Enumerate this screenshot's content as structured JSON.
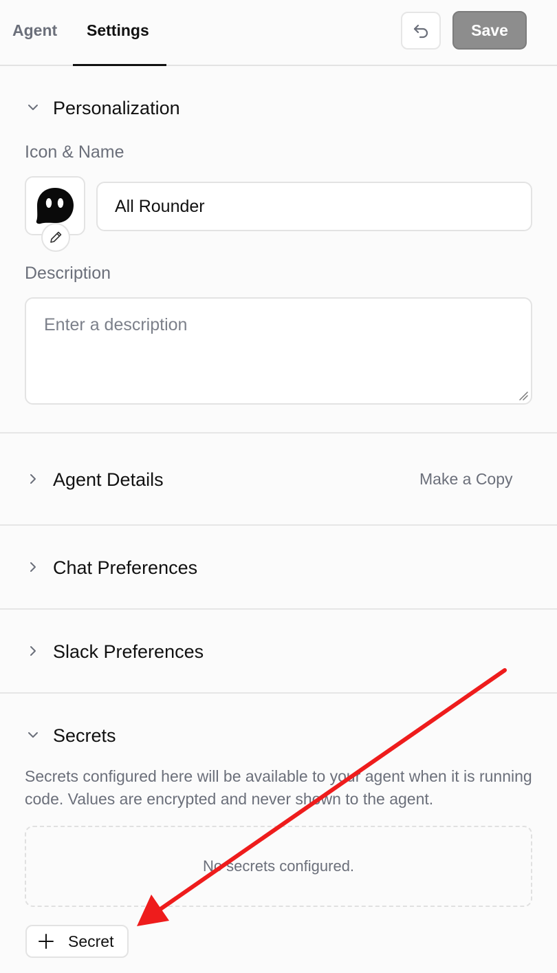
{
  "header": {
    "tabs": [
      {
        "label": "Agent",
        "active": false
      },
      {
        "label": "Settings",
        "active": true
      }
    ],
    "undo_icon": "undo-icon",
    "save_label": "Save"
  },
  "personalization": {
    "title": "Personalization",
    "expanded": true,
    "icon_name_label": "Icon & Name",
    "avatar_icon": "ghost-avatar-icon",
    "edit_icon": "pencil-icon",
    "name_value": "All Rounder",
    "description_label": "Description",
    "description_placeholder": "Enter a description"
  },
  "agent_details": {
    "title": "Agent Details",
    "expanded": false,
    "action_label": "Make a Copy"
  },
  "chat_preferences": {
    "title": "Chat Preferences",
    "expanded": false
  },
  "slack_preferences": {
    "title": "Slack Preferences",
    "expanded": false
  },
  "secrets": {
    "title": "Secrets",
    "expanded": true,
    "description": "Secrets configured here will be available to your agent when it is running code. Values are encrypted and never shown to the agent.",
    "empty_message": "No secrets configured.",
    "add_button_label": "Secret",
    "add_icon": "plus-icon"
  },
  "colors": {
    "annotation_arrow": "#ee1c1c",
    "save_button_bg": "#8d8d8d",
    "muted_text": "#6b6f7a"
  }
}
